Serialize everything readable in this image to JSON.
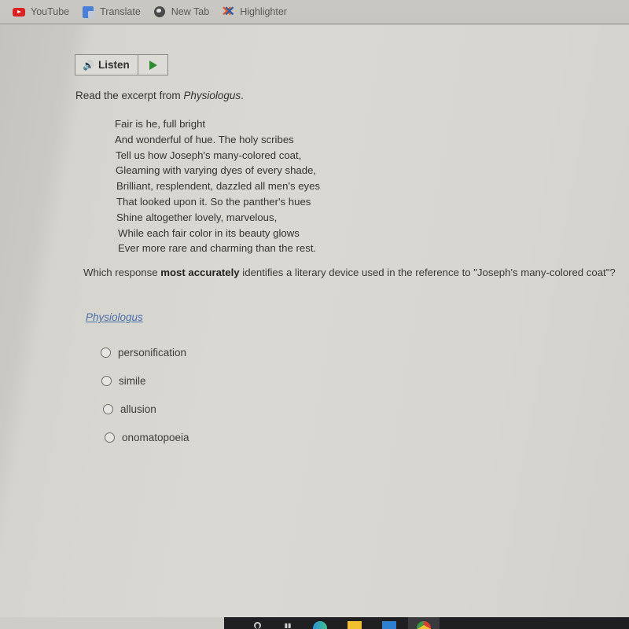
{
  "bookmarks": [
    {
      "label": "YouTube",
      "icon": "youtube-icon"
    },
    {
      "label": "Translate",
      "icon": "translate-icon"
    },
    {
      "label": "New Tab",
      "icon": "globe-icon"
    },
    {
      "label": "Highlighter",
      "icon": "highlighter-icon"
    }
  ],
  "toolbar": {
    "listen_label": "Listen",
    "speaker_icon": "🔊",
    "play_icon": "play-icon"
  },
  "content": {
    "intro_prefix": "Read the excerpt from ",
    "intro_title": "Physiologus",
    "intro_suffix": ".",
    "poem_lines": [
      "Fair is he, full bright",
      "And wonderful of hue. The holy scribes",
      "Tell us how Joseph's many-colored coat,",
      "Gleaming with varying dyes of every shade,",
      "Brilliant, resplendent, dazzled all men's eyes",
      "That looked upon it. So the panther's hues",
      "Shine altogether lovely, marvelous,",
      "While each fair color in its beauty glows",
      "Ever more rare and charming than the rest."
    ],
    "question_prefix": "Which response ",
    "question_bold": "most accurately",
    "question_suffix": " identifies a literary device used in the reference to \"Joseph's many-colored coat\"?",
    "source_link": "Physiologus",
    "options": [
      {
        "label": "personification",
        "selected": false
      },
      {
        "label": "simile",
        "selected": false
      },
      {
        "label": "allusion",
        "selected": false
      },
      {
        "label": "onomatopoeia",
        "selected": false
      }
    ]
  },
  "taskbar": {
    "items": [
      "search-icon",
      "task-view-icon",
      "edge-icon",
      "file-explorer-icon",
      "mail-icon",
      "chrome-icon"
    ]
  }
}
